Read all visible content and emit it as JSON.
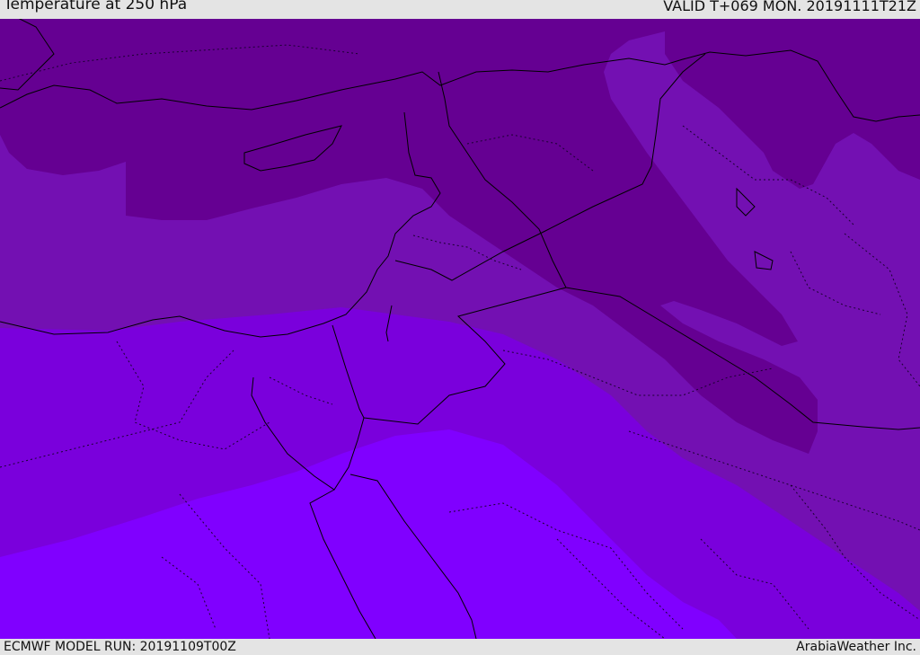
{
  "header": {
    "title": "Temperature at 250 hPa",
    "valid": "VALID T+069 MON. 20191111T21Z"
  },
  "footer": {
    "model_run": "ECMWF MODEL RUN: 20191109T00Z",
    "credit": "ArabiaWeather Inc."
  },
  "colors": {
    "band_darkest": "#650092",
    "band_dark": "#7310B2",
    "band_mid": "#7A00DC",
    "band_light": "#8000FF",
    "boundary_line": "#000000",
    "background": "#e4e4e4"
  }
}
